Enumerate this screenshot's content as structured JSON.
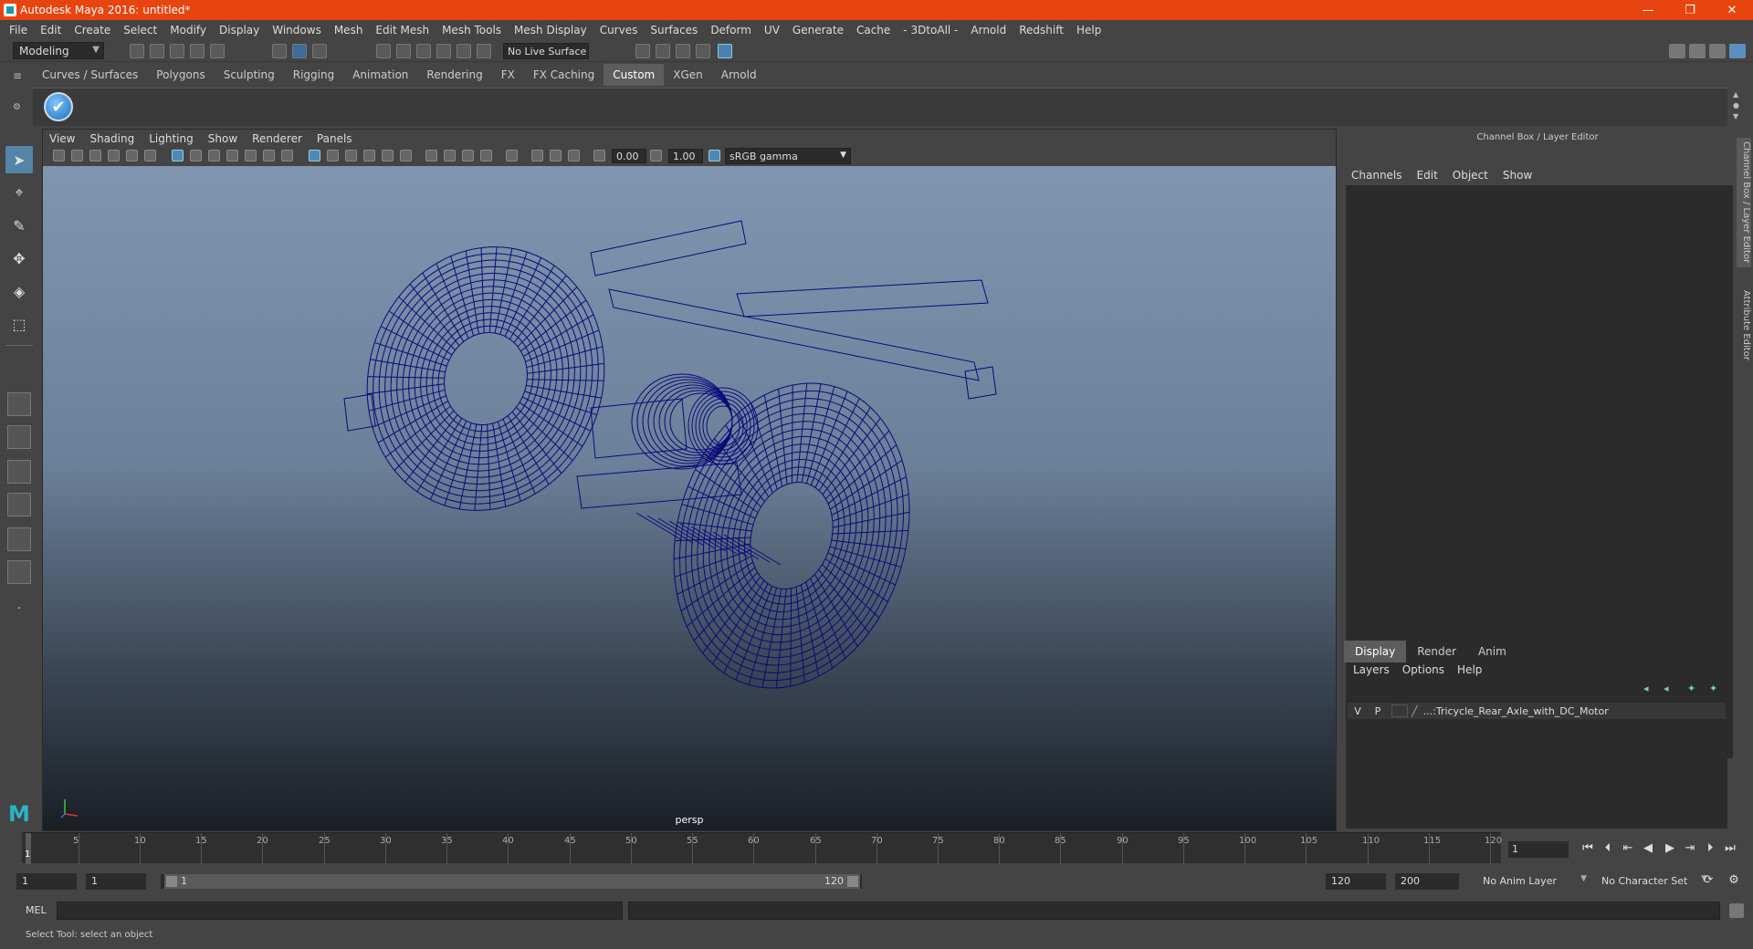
{
  "window": {
    "title": "Autodesk Maya 2016: untitled*",
    "controls": [
      "—",
      "❐",
      "✕"
    ]
  },
  "menubar": [
    "File",
    "Edit",
    "Create",
    "Select",
    "Modify",
    "Display",
    "Windows",
    "Mesh",
    "Edit Mesh",
    "Mesh Tools",
    "Mesh Display",
    "Curves",
    "Surfaces",
    "Deform",
    "UV",
    "Generate",
    "Cache",
    "- 3DtoAll -",
    "Arnold",
    "Redshift",
    "Help"
  ],
  "statusline": {
    "mode": "Modeling",
    "live_surface": "No Live Surface"
  },
  "shelf": {
    "tabs": [
      "Curves / Surfaces",
      "Polygons",
      "Sculpting",
      "Rigging",
      "Animation",
      "Rendering",
      "FX",
      "FX Caching",
      "Custom",
      "XGen",
      "Arnold"
    ],
    "active_tab": "Custom",
    "icon": "check-icon"
  },
  "viewport": {
    "menu": [
      "View",
      "Shading",
      "Lighting",
      "Show",
      "Renderer",
      "Panels"
    ],
    "exposure": "0.00",
    "gamma": "1.00",
    "color_management": "sRGB gamma",
    "camera_label": "persp"
  },
  "channel_box": {
    "header": "Channel Box / Layer Editor",
    "menu": [
      "Channels",
      "Edit",
      "Object",
      "Show"
    ],
    "side_tabs": [
      "Channel Box / Layer Editor",
      "Attribute Editor"
    ]
  },
  "layer_editor": {
    "tabs": [
      "Display",
      "Render",
      "Anim"
    ],
    "active_tab": "Display",
    "menu": [
      "Layers",
      "Options",
      "Help"
    ],
    "layers": [
      {
        "visible": "V",
        "playback": "P",
        "name": "...:Tricycle_Rear_Axle_with_DC_Motor"
      }
    ]
  },
  "timeline": {
    "ticks": [
      "5",
      "10",
      "15",
      "20",
      "25",
      "30",
      "35",
      "40",
      "45",
      "50",
      "55",
      "60",
      "65",
      "70",
      "75",
      "80",
      "85",
      "90",
      "95",
      "100",
      "105",
      "110",
      "115",
      "120"
    ],
    "current_frame_marker": "1",
    "current_frame": "1"
  },
  "range": {
    "start": "1",
    "playback_start": "1",
    "slider_start": "1",
    "slider_end": "120",
    "playback_end": "120",
    "end": "200",
    "anim_layer": "No Anim Layer",
    "character_set": "No Character Set"
  },
  "command_line": {
    "label": "MEL"
  },
  "help_line": "Select Tool: select an object",
  "colors": {
    "title_bar": "#e8440f",
    "wireframe": "#0a0a7a",
    "accent": "#5285a6"
  }
}
